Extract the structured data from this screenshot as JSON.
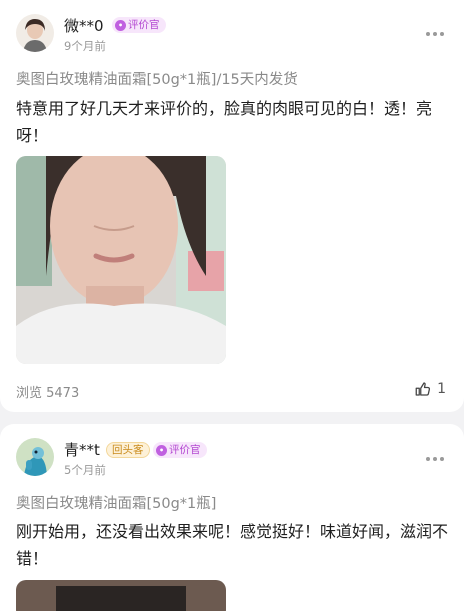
{
  "reviews": [
    {
      "username": "微**0",
      "badges": [
        {
          "type": "reviewer",
          "icon": "reviewer-badge-icon",
          "label": "评价官"
        }
      ],
      "time": "9个月前",
      "product": "奥图白玫瑰精油面霜[50g*1瓶]/15天内发货",
      "content": "特意用了好几天才来评价的，脸真的肉眼可见的白！透！亮呀！",
      "views": "浏览 5473",
      "likes": "1"
    },
    {
      "username": "青**t",
      "badges": [
        {
          "type": "repeat",
          "label": "回头客"
        },
        {
          "type": "reviewer",
          "icon": "reviewer-badge-icon",
          "label": "评价官"
        }
      ],
      "time": "5个月前",
      "product": "奥图白玫瑰精油面霜[50g*1瓶]",
      "content": "刚开始用，还没看出效果来呢！感觉挺好！味道好闻，滋润不错！"
    }
  ],
  "colors": {
    "reviewer_badge": "#c060e0",
    "repeat_badge": "#c98a1b",
    "muted_text": "#8a8a8a"
  }
}
